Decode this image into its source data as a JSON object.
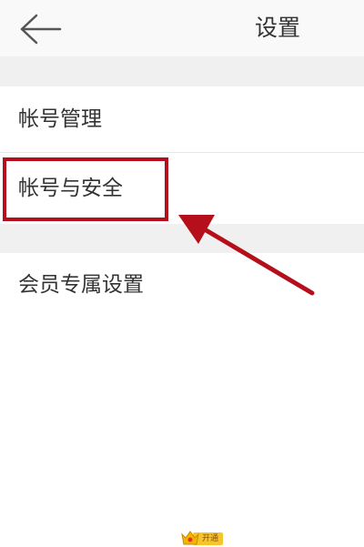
{
  "header": {
    "title": "设置",
    "back_icon": "arrow-left-icon"
  },
  "settings": {
    "items": [
      {
        "label": "帐号管理"
      },
      {
        "label": "帐号与安全",
        "highlighted": true
      },
      {
        "label": "会员专属设置",
        "badge": {
          "icon": "crown-icon",
          "label": "开通"
        }
      }
    ]
  },
  "annotation": {
    "box_color": "#b40f1a",
    "arrow_color": "#b40f1a",
    "arrow_icon": "arrow-pointer-icon"
  }
}
